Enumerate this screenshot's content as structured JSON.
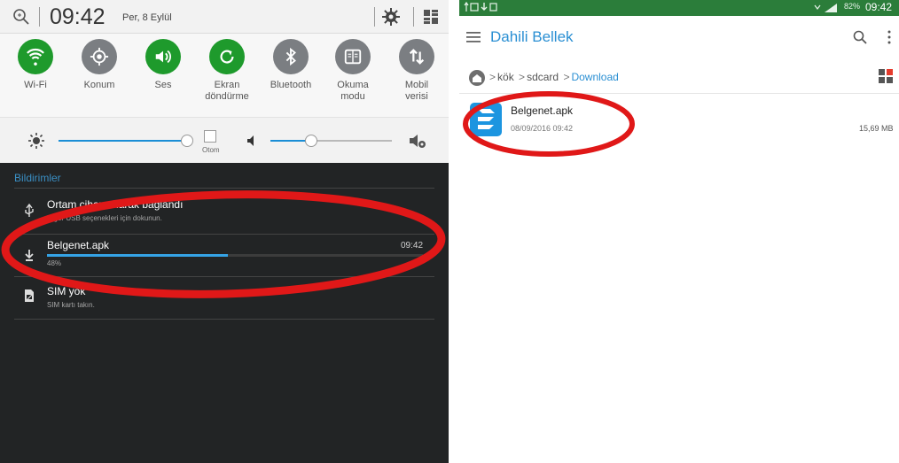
{
  "left": {
    "clock": "09:42",
    "date": "Per, 8 Eylül",
    "quick_settings": [
      {
        "label_line1": "Wi-Fi",
        "label_line2": "",
        "icon": "wifi-icon",
        "state": "on"
      },
      {
        "label_line1": "Konum",
        "label_line2": "",
        "icon": "location-icon",
        "state": "off"
      },
      {
        "label_line1": "Ses",
        "label_line2": "",
        "icon": "sound-icon",
        "state": "on"
      },
      {
        "label_line1": "Ekran",
        "label_line2": "döndürme",
        "icon": "rotate-icon",
        "state": "on"
      },
      {
        "label_line1": "Bluetooth",
        "label_line2": "",
        "icon": "bluetooth-icon",
        "state": "off"
      },
      {
        "label_line1": "Okuma",
        "label_line2": "modu",
        "icon": "reading-mode-icon",
        "state": "off"
      },
      {
        "label_line1": "Mobil",
        "label_line2": "verisi",
        "icon": "mobile-data-icon",
        "state": "off"
      }
    ],
    "brightness_auto_label": "Otom",
    "notifications_header": "Bildirimler",
    "notifications": [
      {
        "title": "Ortam cihazı olarak bağlandı",
        "subtitle": "Diğer USB seçenekleri için dokunun.",
        "time": "",
        "icon": "usb-icon"
      },
      {
        "title": "Belgenet.apk",
        "subtitle": "48%",
        "time": "09:42",
        "icon": "download-icon",
        "progress": 0.48
      },
      {
        "title": "SIM yok",
        "subtitle": "SIM kartı takın.",
        "time": "",
        "icon": "sim-card-icon"
      }
    ]
  },
  "right": {
    "status_bar": {
      "battery": "82%",
      "time": "09:42"
    },
    "title": "Dahili Bellek",
    "breadcrumbs": [
      "kök",
      "sdcard",
      "Download"
    ],
    "file": {
      "name": "Belgenet.apk",
      "date": "08/09/2016 09:42",
      "size": "15,69 MB"
    }
  },
  "colors": {
    "accent": "#2a8fd3",
    "qs_on": "#1e9a2c",
    "annotation_red": "#e01818"
  }
}
